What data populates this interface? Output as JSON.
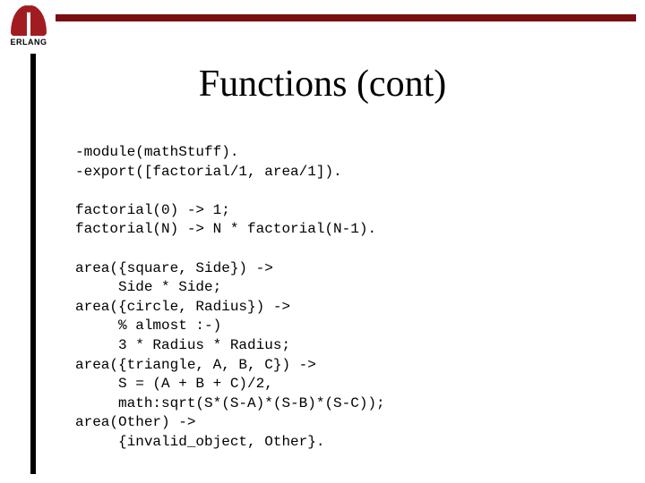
{
  "logo": {
    "text": "ERLANG"
  },
  "title": "Functions (cont)",
  "code": {
    "l1": "-module(mathStuff).",
    "l2": "-export([factorial/1, area/1]).",
    "l3": "",
    "l4": "factorial(0) -> 1;",
    "l5": "factorial(N) -> N * factorial(N-1).",
    "l6": "",
    "l7": "area({square, Side}) ->",
    "l8": "     Side * Side;",
    "l9": "area({circle, Radius}) ->",
    "l10": "     % almost :-)",
    "l11": "     3 * Radius * Radius;",
    "l12": "area({triangle, A, B, C}) ->",
    "l13": "     S = (A + B + C)/2,",
    "l14": "     math:sqrt(S*(S-A)*(S-B)*(S-C));",
    "l15": "area(Other) ->",
    "l16": "     {invalid_object, Other}."
  }
}
